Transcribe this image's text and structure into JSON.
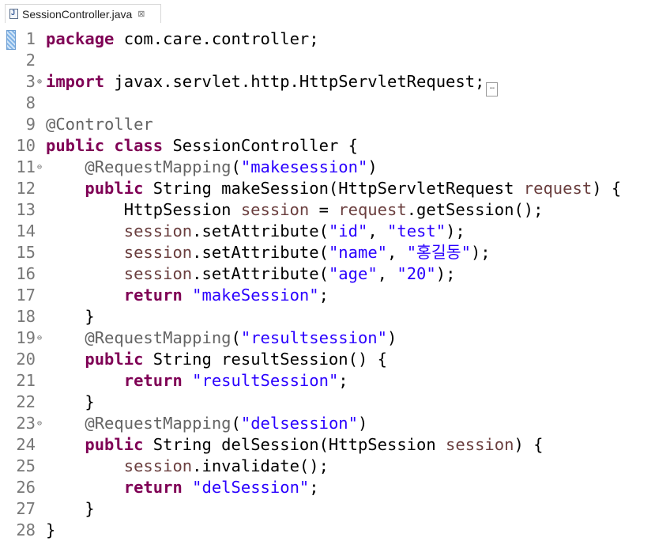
{
  "tab": {
    "title": "SessionController.java",
    "close_symbol": "⊠",
    "icon": "java-file-icon"
  },
  "editor": {
    "folded_marker": "…",
    "lines": [
      {
        "num": "1",
        "fold": "",
        "tokens": [
          [
            "kw",
            "package"
          ],
          [
            "plain",
            " com.care.controller;"
          ]
        ]
      },
      {
        "num": "2",
        "fold": "",
        "tokens": []
      },
      {
        "num": "3",
        "fold": "⊕",
        "tokens": [
          [
            "kw",
            "import"
          ],
          [
            "plain",
            " javax.servlet.http.HttpServletRequest;"
          ]
        ],
        "collapsed": true
      },
      {
        "num": "8",
        "fold": "",
        "tokens": []
      },
      {
        "num": "9",
        "fold": "",
        "tokens": [
          [
            "ann",
            "@Controller"
          ]
        ]
      },
      {
        "num": "10",
        "fold": "",
        "tokens": [
          [
            "kw",
            "public"
          ],
          [
            "plain",
            " "
          ],
          [
            "kw",
            "class"
          ],
          [
            "plain",
            " SessionController {"
          ]
        ]
      },
      {
        "num": "11",
        "fold": "⊖",
        "tokens": [
          [
            "plain",
            "    "
          ],
          [
            "ann",
            "@RequestMapping"
          ],
          [
            "plain",
            "("
          ],
          [
            "str",
            "\"makesession\""
          ],
          [
            "plain",
            ")"
          ]
        ]
      },
      {
        "num": "12",
        "fold": "",
        "tokens": [
          [
            "plain",
            "    "
          ],
          [
            "kw",
            "public"
          ],
          [
            "plain",
            " String makeSession(HttpServletRequest "
          ],
          [
            "var",
            "request"
          ],
          [
            "plain",
            ") {"
          ]
        ]
      },
      {
        "num": "13",
        "fold": "",
        "tokens": [
          [
            "plain",
            "        HttpSession "
          ],
          [
            "var",
            "session"
          ],
          [
            "plain",
            " = "
          ],
          [
            "var",
            "request"
          ],
          [
            "plain",
            ".getSession();"
          ]
        ]
      },
      {
        "num": "14",
        "fold": "",
        "tokens": [
          [
            "plain",
            "        "
          ],
          [
            "var",
            "session"
          ],
          [
            "plain",
            ".setAttribute("
          ],
          [
            "str",
            "\"id\""
          ],
          [
            "plain",
            ", "
          ],
          [
            "str",
            "\"test\""
          ],
          [
            "plain",
            ");"
          ]
        ]
      },
      {
        "num": "15",
        "fold": "",
        "tokens": [
          [
            "plain",
            "        "
          ],
          [
            "var",
            "session"
          ],
          [
            "plain",
            ".setAttribute("
          ],
          [
            "str",
            "\"name\""
          ],
          [
            "plain",
            ", "
          ],
          [
            "str",
            "\"홍길동\""
          ],
          [
            "plain",
            ");"
          ]
        ]
      },
      {
        "num": "16",
        "fold": "",
        "tokens": [
          [
            "plain",
            "        "
          ],
          [
            "var",
            "session"
          ],
          [
            "plain",
            ".setAttribute("
          ],
          [
            "str",
            "\"age\""
          ],
          [
            "plain",
            ", "
          ],
          [
            "str",
            "\"20\""
          ],
          [
            "plain",
            ");"
          ]
        ]
      },
      {
        "num": "17",
        "fold": "",
        "tokens": [
          [
            "plain",
            "        "
          ],
          [
            "kw",
            "return"
          ],
          [
            "plain",
            " "
          ],
          [
            "str",
            "\"makeSession\""
          ],
          [
            "plain",
            ";"
          ]
        ]
      },
      {
        "num": "18",
        "fold": "",
        "tokens": [
          [
            "plain",
            "    }"
          ]
        ]
      },
      {
        "num": "19",
        "fold": "⊖",
        "tokens": [
          [
            "plain",
            "    "
          ],
          [
            "ann",
            "@RequestMapping"
          ],
          [
            "plain",
            "("
          ],
          [
            "str",
            "\"resultsession\""
          ],
          [
            "plain",
            ")"
          ]
        ]
      },
      {
        "num": "20",
        "fold": "",
        "tokens": [
          [
            "plain",
            "    "
          ],
          [
            "kw",
            "public"
          ],
          [
            "plain",
            " String resultSession() {"
          ]
        ]
      },
      {
        "num": "21",
        "fold": "",
        "tokens": [
          [
            "plain",
            "        "
          ],
          [
            "kw",
            "return"
          ],
          [
            "plain",
            " "
          ],
          [
            "str",
            "\"resultSession\""
          ],
          [
            "plain",
            ";"
          ]
        ]
      },
      {
        "num": "22",
        "fold": "",
        "tokens": [
          [
            "plain",
            "    }"
          ]
        ]
      },
      {
        "num": "23",
        "fold": "⊖",
        "tokens": [
          [
            "plain",
            "    "
          ],
          [
            "ann",
            "@RequestMapping"
          ],
          [
            "plain",
            "("
          ],
          [
            "str",
            "\"delsession\""
          ],
          [
            "plain",
            ")"
          ]
        ]
      },
      {
        "num": "24",
        "fold": "",
        "tokens": [
          [
            "plain",
            "    "
          ],
          [
            "kw",
            "public"
          ],
          [
            "plain",
            " String delSession(HttpSession "
          ],
          [
            "var",
            "session"
          ],
          [
            "plain",
            ") {"
          ]
        ]
      },
      {
        "num": "25",
        "fold": "",
        "tokens": [
          [
            "plain",
            "        "
          ],
          [
            "var",
            "session"
          ],
          [
            "plain",
            ".invalidate();"
          ]
        ]
      },
      {
        "num": "26",
        "fold": "",
        "tokens": [
          [
            "plain",
            "        "
          ],
          [
            "kw",
            "return"
          ],
          [
            "plain",
            " "
          ],
          [
            "str",
            "\"delSession\""
          ],
          [
            "plain",
            ";"
          ]
        ]
      },
      {
        "num": "27",
        "fold": "",
        "tokens": [
          [
            "plain",
            "    }"
          ]
        ]
      },
      {
        "num": "28",
        "fold": "",
        "tokens": [
          [
            "plain",
            "}"
          ]
        ]
      }
    ]
  },
  "colors": {
    "keyword": "#7f0055",
    "string": "#2a00ff",
    "annotation": "#646464",
    "local_variable": "#6a3e3e",
    "line_number": "#787878"
  }
}
